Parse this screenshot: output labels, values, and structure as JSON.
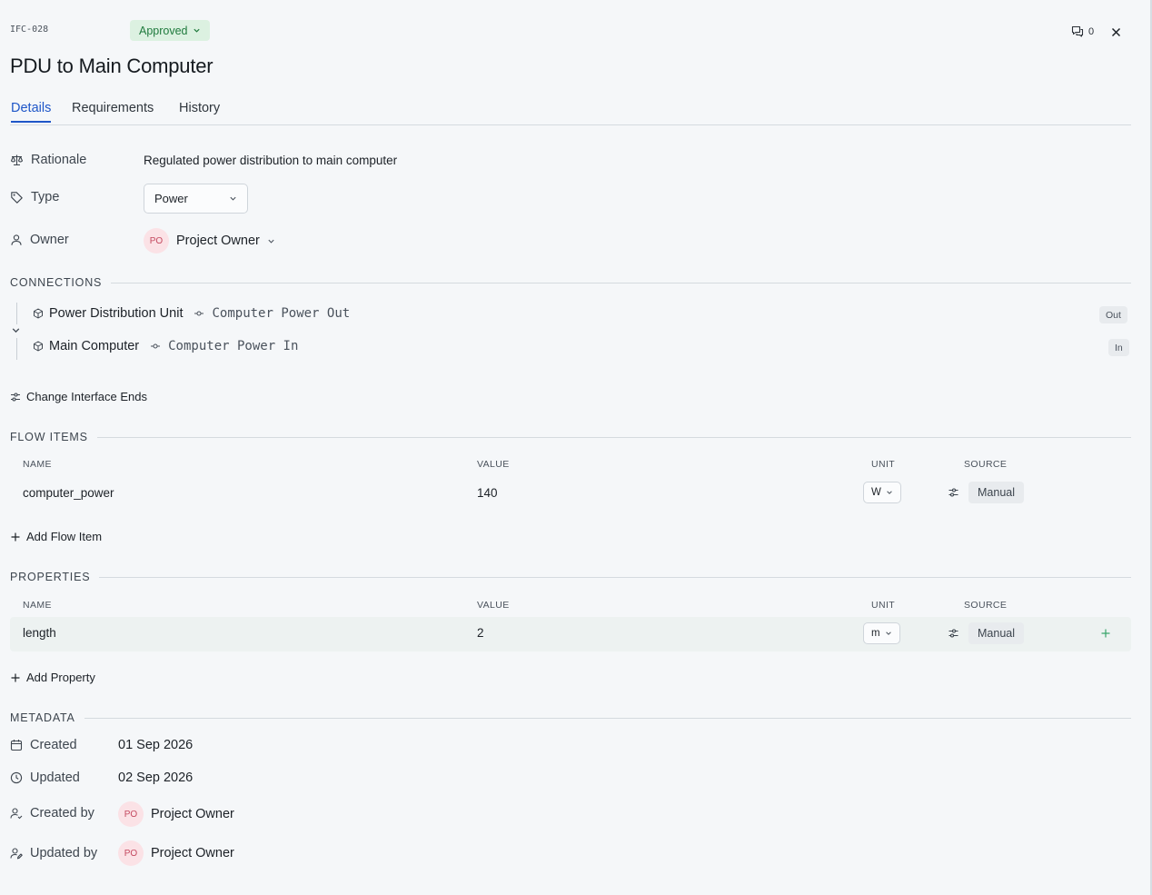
{
  "header": {
    "id": "IFC-028",
    "status": "Approved",
    "comment_count": "0",
    "title": "PDU to Main Computer"
  },
  "tabs": [
    {
      "label": "Details",
      "active": true
    },
    {
      "label": "Requirements",
      "active": false
    },
    {
      "label": "History",
      "active": false
    }
  ],
  "fields": {
    "rationale_label": "Rationale",
    "rationale_value": "Regulated power distribution to main computer",
    "type_label": "Type",
    "type_value": "Power",
    "owner_label": "Owner",
    "owner_initials": "PO",
    "owner_name": "Project Owner"
  },
  "connections": {
    "heading": "CONNECTIONS",
    "items": [
      {
        "component": "Power Distribution Unit",
        "port": "Computer Power Out",
        "direction": "Out"
      },
      {
        "component": "Main Computer",
        "port": "Computer Power In",
        "direction": "In"
      }
    ],
    "change_label": "Change Interface Ends"
  },
  "flow_items": {
    "heading": "FLOW ITEMS",
    "columns": [
      "NAME",
      "VALUE",
      "UNIT",
      "SOURCE"
    ],
    "rows": [
      {
        "name": "computer_power",
        "value": "140",
        "unit": "W",
        "source": "Manual"
      }
    ],
    "add_label": "Add Flow Item"
  },
  "properties": {
    "heading": "PROPERTIES",
    "columns": [
      "NAME",
      "VALUE",
      "UNIT",
      "SOURCE"
    ],
    "rows": [
      {
        "name": "length",
        "value": "2",
        "unit": "m",
        "source": "Manual"
      }
    ],
    "add_label": "Add Property"
  },
  "metadata": {
    "heading": "METADATA",
    "created_label": "Created",
    "created_value": "01 Sep 2026",
    "updated_label": "Updated",
    "updated_value": "02 Sep 2026",
    "created_by_label": "Created by",
    "created_by_initials": "PO",
    "created_by_name": "Project Owner",
    "updated_by_label": "Updated by",
    "updated_by_initials": "PO",
    "updated_by_name": "Project Owner"
  },
  "colors": {
    "accent": "#1e56c8",
    "status_bg": "#dcf1e1",
    "status_text": "#1f7a3d",
    "avatar_bg": "#fbe2e6",
    "avatar_text": "#c4485f"
  }
}
